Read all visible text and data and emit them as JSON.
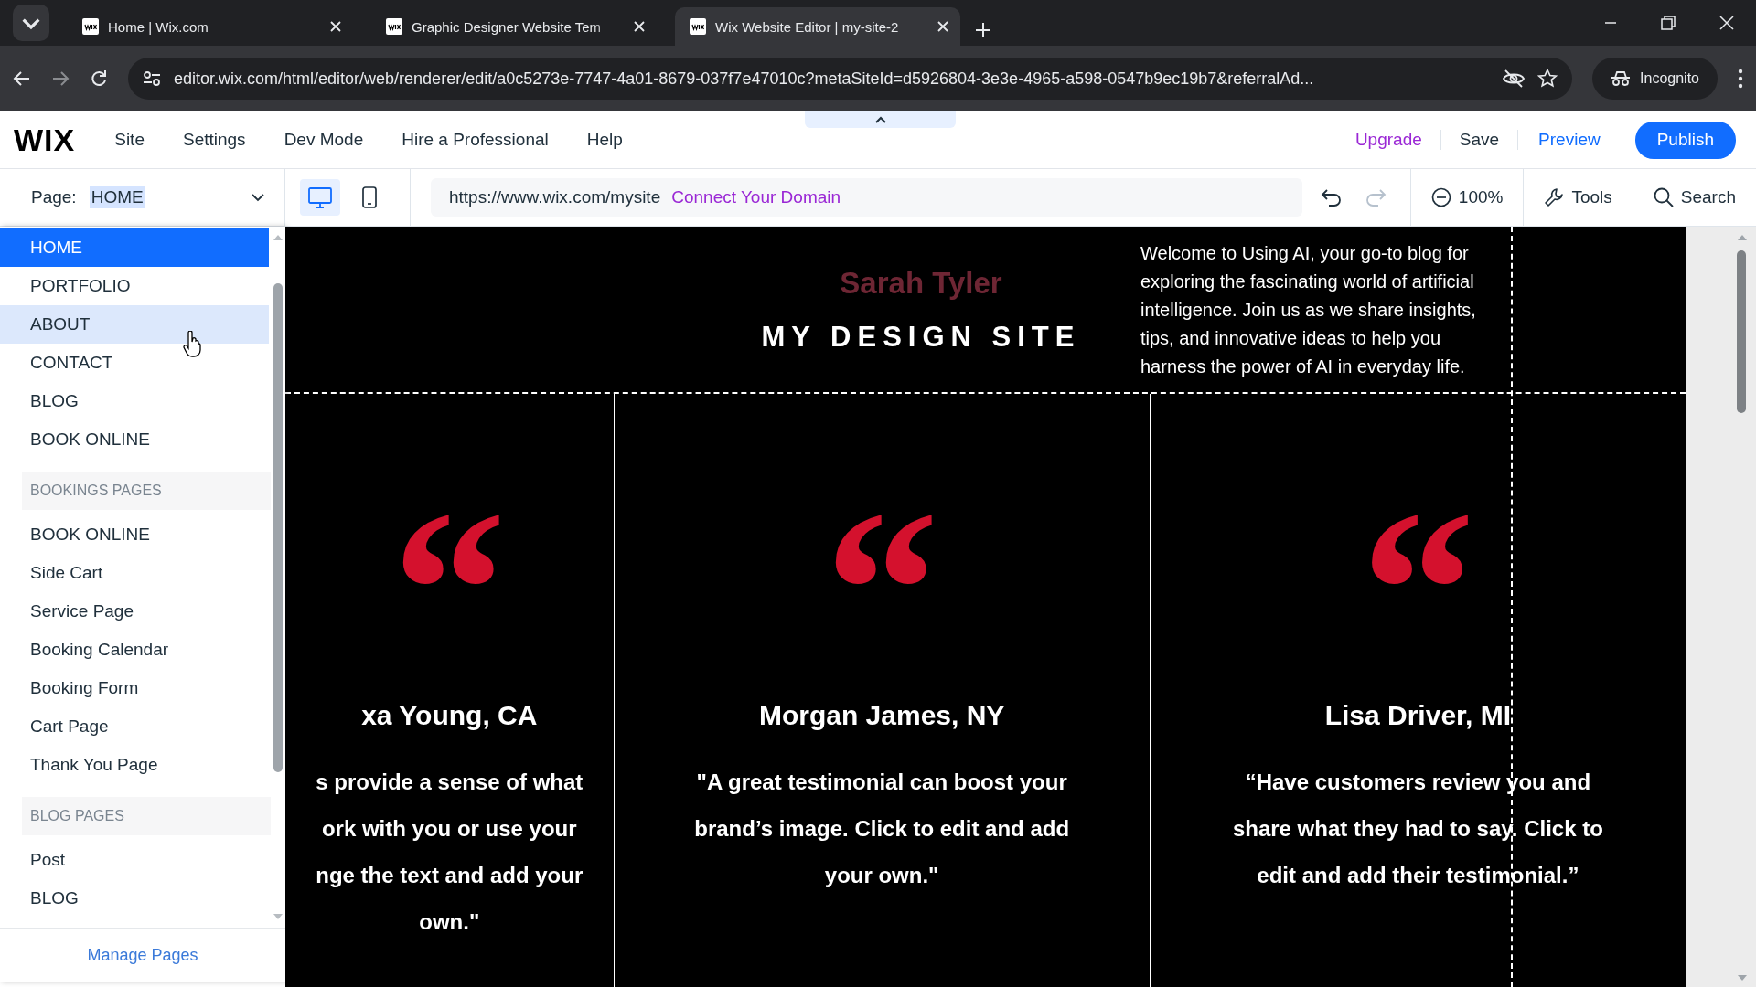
{
  "browser": {
    "tabs": [
      {
        "title": "Home | Wix.com",
        "selected": false
      },
      {
        "title": "Graphic Designer Website Tem",
        "selected": false
      },
      {
        "title": "Wix Website Editor | my-site-2",
        "selected": true
      }
    ],
    "address": "editor.wix.com/html/editor/web/renderer/edit/a0c5273e-7747-4a01-8679-037f7e47010c?metaSiteId=d5926804-3e3e-4965-a598-0547b9ec19b7&referralAd...",
    "profile": "Incognito"
  },
  "editor": {
    "logo": "WIX",
    "menu": [
      "Site",
      "Settings",
      "Dev Mode",
      "Hire a Professional",
      "Help"
    ],
    "actions": [
      {
        "label": "Upgrade",
        "kind": "upgrade"
      },
      {
        "label": "Save",
        "kind": "plain"
      },
      {
        "label": "Preview",
        "kind": "preview"
      },
      {
        "label": "Publish",
        "kind": "primary"
      }
    ]
  },
  "toolbar": {
    "page_label": "Page:",
    "page_value": "HOME",
    "devices": [
      {
        "kind": "desktop",
        "selected": true
      },
      {
        "kind": "mobile",
        "selected": false
      }
    ],
    "site_url": "https://www.wix.com/mysite",
    "domain_link": "Connect Your Domain",
    "redo_disabled": true,
    "zoom": "100%",
    "tools": "Tools",
    "search": "Search"
  },
  "pages_menu": {
    "groups": [
      {
        "items": [
          {
            "label": "HOME",
            "selected": true,
            "hovered": false
          },
          {
            "label": "PORTFOLIO",
            "selected": false,
            "hovered": false
          },
          {
            "label": "ABOUT",
            "selected": false,
            "hovered": true
          },
          {
            "label": "CONTACT",
            "selected": false,
            "hovered": false
          },
          {
            "label": "BLOG",
            "selected": false,
            "hovered": false
          },
          {
            "label": "BOOK ONLINE",
            "selected": false,
            "hovered": false
          }
        ]
      },
      {
        "heading": "BOOKINGS PAGES",
        "items": [
          {
            "label": "BOOK ONLINE",
            "selected": false,
            "hovered": false
          },
          {
            "label": "Side Cart",
            "selected": false,
            "hovered": false
          },
          {
            "label": "Service Page",
            "selected": false,
            "hovered": false
          },
          {
            "label": "Booking Calendar",
            "selected": false,
            "hovered": false
          },
          {
            "label": "Booking Form",
            "selected": false,
            "hovered": false
          },
          {
            "label": "Cart Page",
            "selected": false,
            "hovered": false
          },
          {
            "label": "Thank You Page",
            "selected": false,
            "hovered": false
          }
        ]
      },
      {
        "heading": "BLOG PAGES",
        "items": [
          {
            "label": "Post",
            "selected": false,
            "hovered": false
          },
          {
            "label": "BLOG",
            "selected": false,
            "hovered": false
          }
        ]
      }
    ],
    "footer": "Manage Pages"
  },
  "site": {
    "header": {
      "name": "Sarah Tyler",
      "title": "MY DESIGN SITE",
      "intro": "Welcome to Using AI, your go-to blog for\nexploring the fascinating world of artificial\nintelligence. Join us as we share insights,\ntips, and innovative ideas to help you\nharness the power of AI in everyday life."
    },
    "testimonials": [
      {
        "mark": "“",
        "name": "xa Young, CA",
        "quote": "s provide a sense of what\nork with you or use your\nnge the text and add your\nown.\""
      },
      {
        "mark": "“",
        "name": "Morgan James, NY",
        "quote": "\"A great testimonial can boost your\nbrand’s image. Click to edit and add\nyour own.\""
      },
      {
        "mark": "“",
        "name": "Lisa Driver, MI",
        "quote": "“Have customers review you and\nshare what they had to say. Click to\nedit and add their testimonial.”"
      }
    ]
  }
}
